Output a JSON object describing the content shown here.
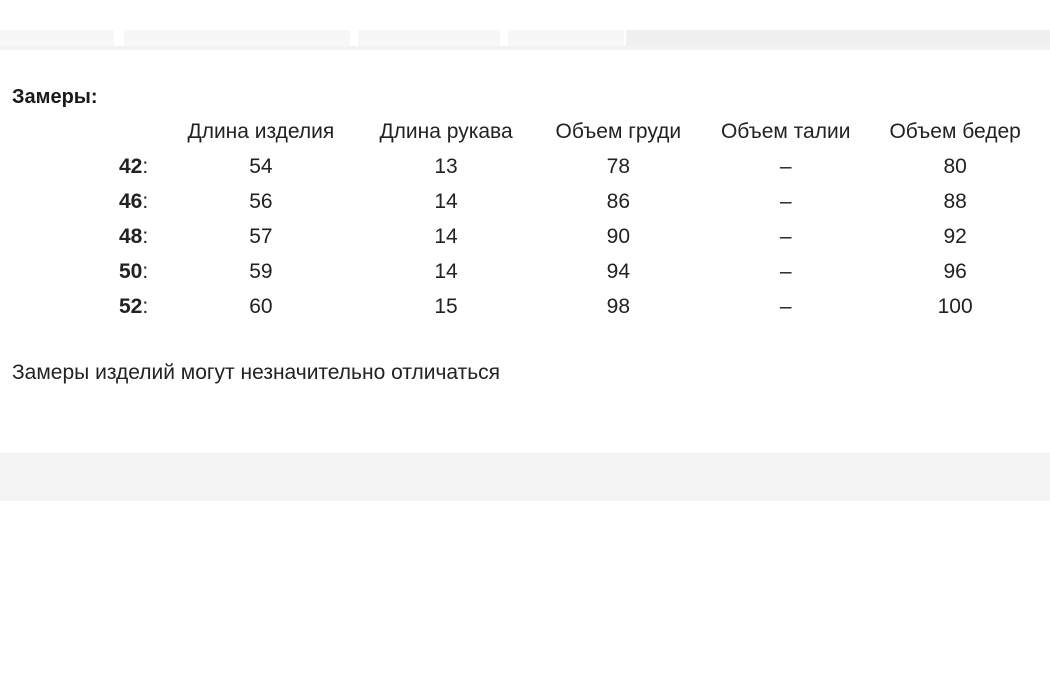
{
  "section_title": "Замеры:",
  "table": {
    "headers": [
      "Длина изделия",
      "Длина рукава",
      "Объем груди",
      "Объем талии",
      "Объем бедер"
    ],
    "rows": [
      {
        "size": "42",
        "values": [
          "54",
          "13",
          "78",
          "–",
          "80"
        ]
      },
      {
        "size": "46",
        "values": [
          "56",
          "14",
          "86",
          "–",
          "88"
        ]
      },
      {
        "size": "48",
        "values": [
          "57",
          "14",
          "90",
          "–",
          "92"
        ]
      },
      {
        "size": "50",
        "values": [
          "59",
          "14",
          "94",
          "–",
          "96"
        ]
      },
      {
        "size": "52",
        "values": [
          "60",
          "15",
          "98",
          "–",
          "100"
        ]
      }
    ]
  },
  "note": "Замеры изделий могут незначительно отличаться"
}
